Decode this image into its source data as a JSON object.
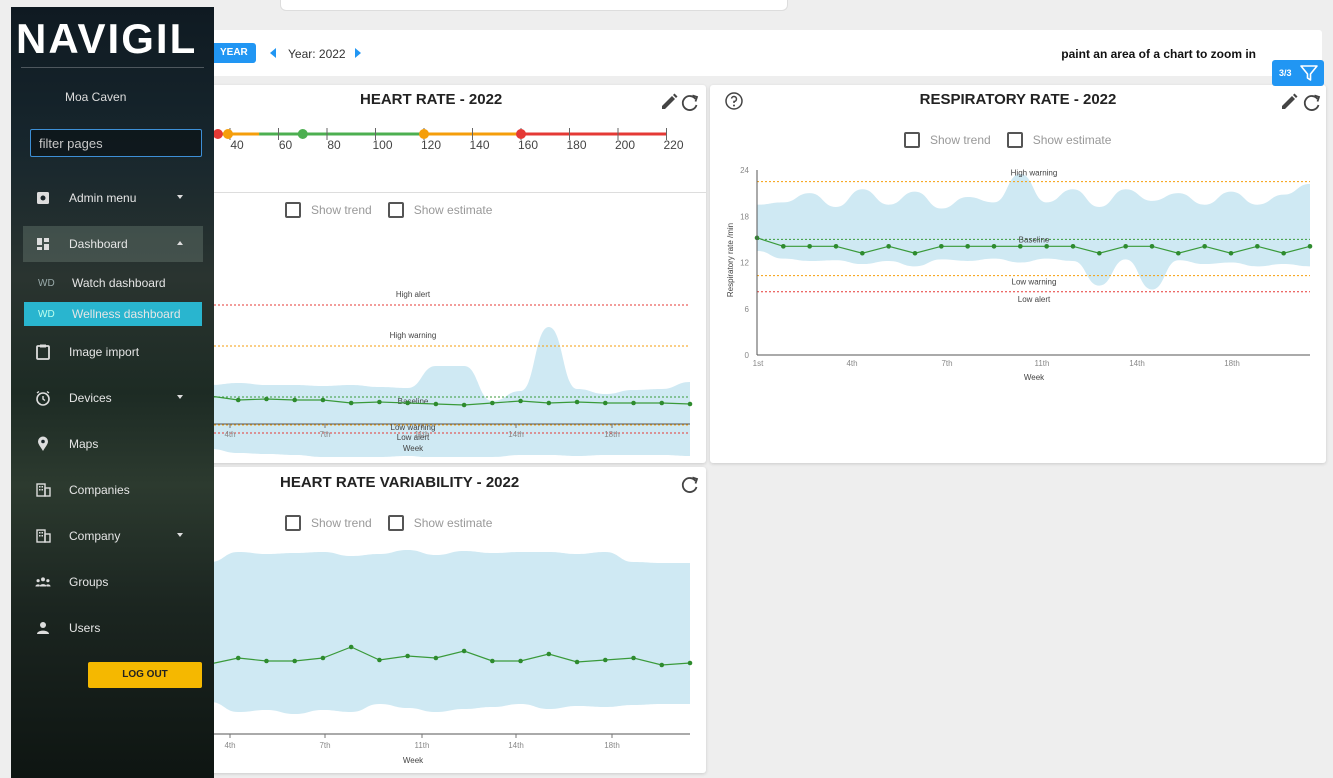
{
  "app": {
    "brand": "NAVIGIL"
  },
  "header": {
    "year_button": "YEAR",
    "year_label": "Year: 2022",
    "zoom_hint": "paint an area of a chart to zoom in",
    "filter_count": "3/3"
  },
  "sidebar": {
    "user_name": "Moa Caven",
    "filter_placeholder": "filter pages",
    "items": [
      {
        "label": "Admin menu",
        "icon": "admin-icon",
        "expandable": true
      },
      {
        "label": "Dashboard",
        "icon": "dashboard-icon",
        "expandable": true,
        "open": true
      },
      {
        "label": "Image import",
        "icon": "clipboard-icon"
      },
      {
        "label": "Devices",
        "icon": "clock-icon",
        "expandable": true
      },
      {
        "label": "Maps",
        "icon": "location-pin-icon"
      },
      {
        "label": "Companies",
        "icon": "building-icon"
      },
      {
        "label": "Company",
        "icon": "building-icon",
        "expandable": true
      },
      {
        "label": "Groups",
        "icon": "groups-icon"
      },
      {
        "label": "Users",
        "icon": "user-icon"
      }
    ],
    "subitems": [
      {
        "abbr": "WD",
        "label": "Watch dashboard"
      },
      {
        "abbr": "WD",
        "label": "Wellness dashboard",
        "active": true
      }
    ],
    "logout": "LOG OUT"
  },
  "controls": {
    "show_trend": "Show trend",
    "show_estimate": "Show estimate"
  },
  "cards": {
    "heart_rate": {
      "title": "HEART RATE - 2022",
      "scale_ticks": [
        "40",
        "60",
        "80",
        "100",
        "120",
        "140",
        "160",
        "180",
        "200",
        "220"
      ]
    },
    "respiratory": {
      "title": "RESPIRATORY RATE - 2022"
    },
    "hrv": {
      "title": "HEART RATE VARIABILITY - 2022"
    }
  },
  "chart_data": [
    {
      "id": "heart-rate",
      "type": "line",
      "xlabel": "Week",
      "x_ticks": [
        "4th",
        "7th",
        "11th",
        "14th",
        "18th"
      ],
      "reference_lines": [
        "High alert",
        "High warning",
        "Baseline",
        "Low warning",
        "Low alert"
      ],
      "series_points": 18,
      "colors": {
        "band": "#cfe9f3",
        "line": "#3a9a3a",
        "alert": "#e53935",
        "warning": "#f59e0b"
      }
    },
    {
      "id": "respiratory-rate",
      "type": "line",
      "xlabel": "Week",
      "ylabel": "Respiratory rate /min",
      "ylim": [
        0,
        24
      ],
      "y_ticks": [
        "0",
        "6",
        "12",
        "18",
        "24"
      ],
      "x_ticks": [
        "1st",
        "4th",
        "7th",
        "11th",
        "14th",
        "18th"
      ],
      "reference_lines": [
        {
          "label": "High warning",
          "value": 22.5
        },
        {
          "label": "Baseline",
          "value": 15
        },
        {
          "label": "Low warning",
          "value": 10.3
        },
        {
          "label": "Low alert",
          "value": 8.2
        }
      ],
      "values": [
        15.2,
        14.1,
        14.1,
        14.1,
        13.2,
        14.1,
        13.2,
        14.1,
        14.1,
        14.1,
        14.1,
        14.1,
        14.1,
        13.2,
        14.1,
        14.1,
        13.2,
        14.1,
        13.2,
        14.1,
        13.2,
        14.1
      ],
      "band_upper": [
        19.5,
        19.8,
        21,
        19.2,
        21.5,
        19.5,
        21.2,
        19,
        20.5,
        19.8,
        23.5,
        19.8,
        21.5,
        19.2,
        21.5,
        20,
        21,
        19.5,
        21.2,
        19.5,
        20.8,
        22.2
      ],
      "band_lower": [
        13.5,
        12.5,
        12.2,
        12.3,
        11.8,
        12.2,
        11.5,
        12.4,
        12.2,
        12.5,
        12,
        12.5,
        12.2,
        9,
        12.4,
        8.5,
        12.3,
        11.8,
        12,
        11.5,
        11.8,
        11.5
      ]
    },
    {
      "id": "hrv",
      "type": "line",
      "xlabel": "Week",
      "x_ticks": [
        "4th",
        "7th",
        "11th",
        "14th",
        "18th"
      ],
      "series_points": 18
    }
  ]
}
